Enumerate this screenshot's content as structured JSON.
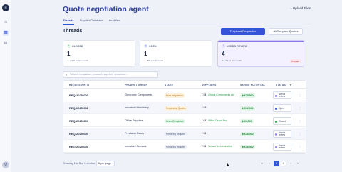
{
  "sidebar": {
    "logo_glyph": "≡",
    "icons": [
      "home-icon",
      "grid-icon",
      "link-icon"
    ],
    "avatar": "U"
  },
  "header": {
    "title": "Quote negotiation agent",
    "upload_files": "+ Upload Files"
  },
  "tabs": [
    {
      "label": "Threads",
      "active": true
    },
    {
      "label": "Supplier Database",
      "active": false
    },
    {
      "label": "Analytics",
      "active": false
    }
  ],
  "section": {
    "title": "Threads",
    "upload_requisition": "Upload Requisition",
    "compare_quotes": "Compare Quotes"
  },
  "cards": [
    {
      "label": "CLOSED",
      "value": "1",
      "delta": "+12% vs last month",
      "direction": "up",
      "icon": "check-circle-icon",
      "color": "#2aa148"
    },
    {
      "label": "OPEN",
      "value": "1",
      "delta": "-8% vs last month",
      "direction": "down",
      "icon": "clock-icon",
      "color": "#3553d8"
    },
    {
      "label": "NEEDS REVIEW",
      "value": "4",
      "delta": "+4% vs last month",
      "direction": "up",
      "tag": "3 urgent",
      "icon": "alert-icon",
      "color": "#8a78e8"
    }
  ],
  "search": {
    "placeholder": "Search requisition, product, supplier, requestor..."
  },
  "table": {
    "columns": [
      "REQUISITION ID",
      "PRODUCT GROUP",
      "STAGE",
      "SUPPLIERS",
      "SAVING POTENTIAL",
      "STATUS"
    ],
    "rows": [
      {
        "id": "REQ-2025-001",
        "group": "Electronic Components",
        "stage": "Price Negotiation",
        "stage_color": "#b7791f",
        "stage_bg": "#fdf1dc",
        "suppliers": "3",
        "best": "Global Components Ltd",
        "saving": "€28,500",
        "status": "Needs review",
        "status_color": "#8a78e8"
      },
      {
        "id": "REQ-2025-002",
        "group": "Industrial Machinery",
        "stage": "Requesting Quotes",
        "stage_color": "#b7791f",
        "stage_bg": "#fdf1dc",
        "suppliers": "2",
        "best": "",
        "saving": "€42,000",
        "status": "Open",
        "status_color": "#3553d8"
      },
      {
        "id": "REQ-2025-003",
        "group": "Office Supplies",
        "stage": "Order Completed",
        "stage_color": "#1f8a43",
        "stage_bg": "#e3f6e8",
        "suppliers": "2",
        "best": "Office Depot Pro",
        "saving": "€4,500",
        "status": "Closed",
        "status_color": "#2aa148"
      },
      {
        "id": "REQ-2025-004",
        "group": "Precision Gears",
        "stage": "Preparing Request",
        "stage_color": "#4a5578",
        "stage_bg": "#eceff6",
        "suppliers": "3",
        "best": "",
        "saving": "€38,000",
        "status": "Needs review",
        "status_color": "#8a78e8"
      },
      {
        "id": "REQ-2025-005",
        "group": "Industrial Sensors",
        "stage": "Preparing Request",
        "stage_color": "#4a5578",
        "stage_bg": "#eceff6",
        "suppliers": "3",
        "best": "SensorTech Industrial",
        "saving": "€36,000",
        "status": "Needs review",
        "status_color": "#8a78e8"
      }
    ]
  },
  "footer": {
    "showing": "Showing 1 to 5 of 6 entries",
    "per_page": "5 per page",
    "pages": [
      "«",
      "‹",
      "1",
      "2",
      "›",
      "»"
    ],
    "current_page": "1"
  }
}
